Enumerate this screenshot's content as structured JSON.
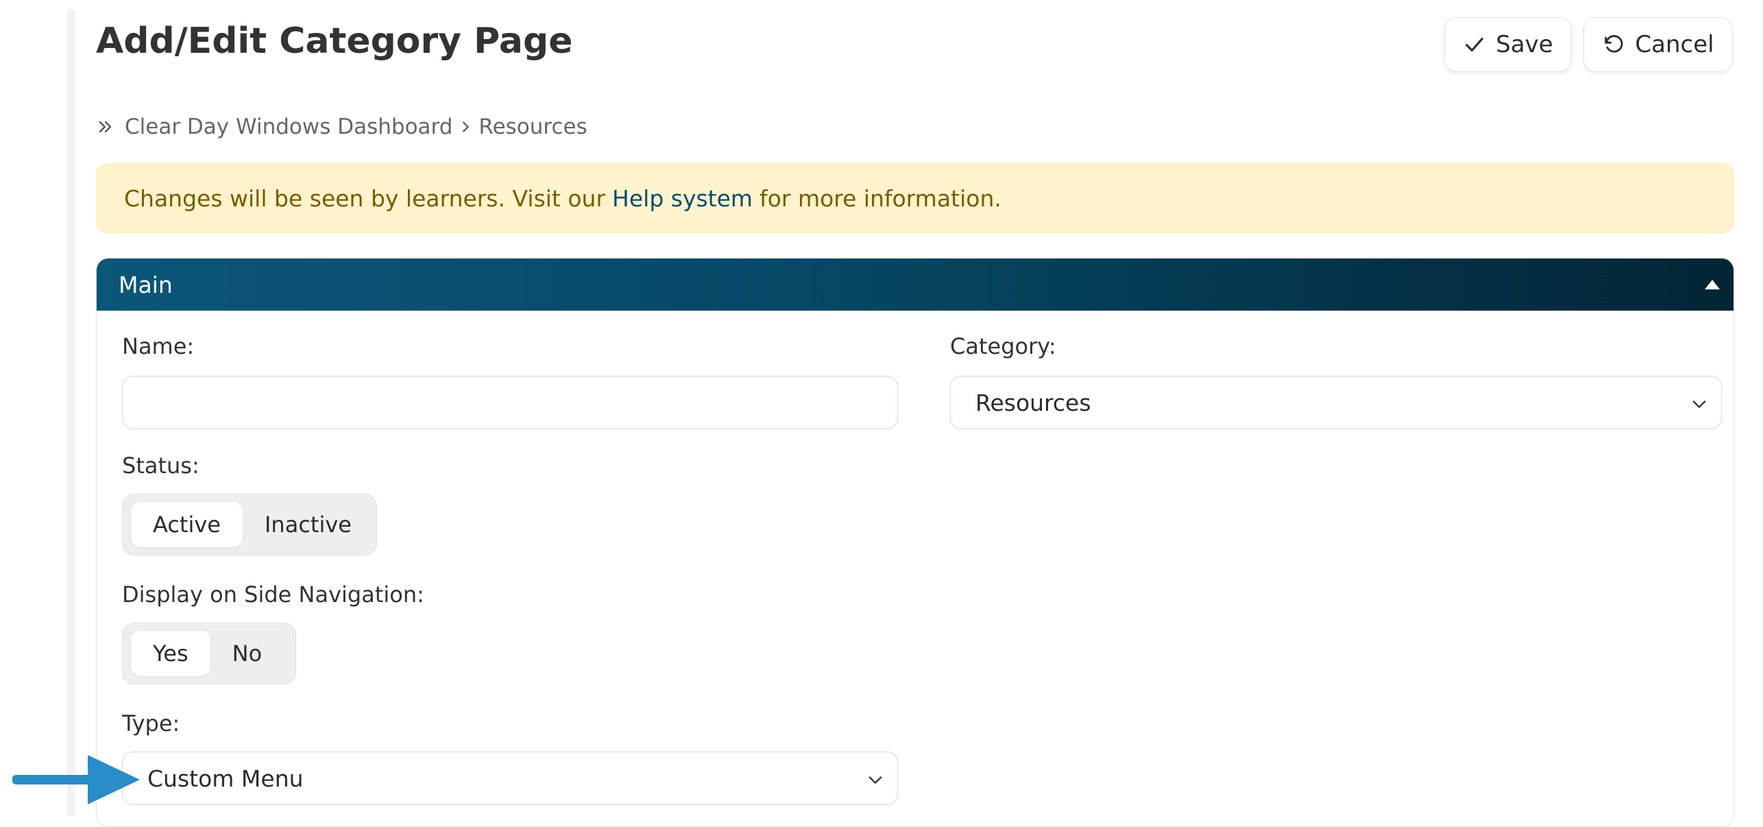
{
  "page": {
    "title": "Add/Edit Category Page"
  },
  "toolbar": {
    "save_label": "Save",
    "cancel_label": "Cancel"
  },
  "breadcrumb": {
    "items": [
      "Clear Day Windows Dashboard",
      "Resources"
    ]
  },
  "alert": {
    "text_before": "Changes will be seen by learners. Visit our",
    "link_text": "Help system",
    "text_after": "for more information."
  },
  "panel": {
    "title": "Main"
  },
  "form": {
    "name": {
      "label": "Name:",
      "value": ""
    },
    "category": {
      "label": "Category:",
      "selected": "Resources"
    },
    "status": {
      "label": "Status:",
      "options": [
        "Active",
        "Inactive"
      ],
      "selected": "Active"
    },
    "side_nav": {
      "label": "Display on Side Navigation:",
      "options": [
        "Yes",
        "No"
      ],
      "selected": "Yes"
    },
    "type": {
      "label": "Type:",
      "selected": "Custom Menu"
    }
  },
  "colors": {
    "header_gradient_start": "#0b5679",
    "header_gradient_end": "#032535",
    "alert_bg": "#fef3cc",
    "alert_text": "#7a5a00",
    "link": "#0a4a72",
    "arrow": "#2a8cc8"
  },
  "icons": {
    "save": "check-icon",
    "cancel": "undo-icon",
    "breadcrumb_start": "double-chevron-right-icon",
    "breadcrumb_sep": "chevron-right-icon",
    "panel_toggle": "caret-up-icon",
    "select_chevron": "chevron-down-icon",
    "annotation": "arrow-right-icon"
  }
}
